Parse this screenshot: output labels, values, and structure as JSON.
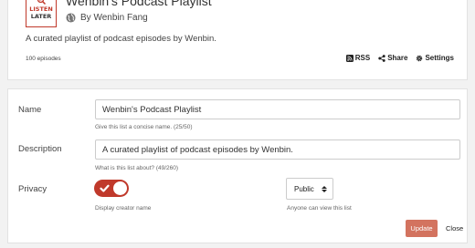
{
  "logo": {
    "line1": "LISTEN",
    "line2": "LATER"
  },
  "header": {
    "title": "Wenbin's Podcast Playlist",
    "byline": "By Wenbin Fang",
    "description": "A curated playlist of podcast episodes by Wenbin.",
    "episode_count": "100 episodes",
    "actions": {
      "rss": "RSS",
      "share": "Share",
      "settings": "Settings"
    }
  },
  "form": {
    "name": {
      "label": "Name",
      "value": "Wenbin's Podcast Playlist",
      "hint": "Give this list a concise name. (25/50)"
    },
    "description": {
      "label": "Description",
      "value": "A curated playlist of podcast episodes by Wenbin.",
      "hint": "What is this list about? (49/260)"
    },
    "privacy": {
      "label": "Privacy",
      "toggle_on": true,
      "toggle_hint": "Display creator name",
      "select_value": "Public",
      "select_hint": "Anyone can view this list"
    },
    "update_label": "Update",
    "close_label": "Close"
  },
  "colors": {
    "accent": "#c0392b",
    "update_button": "#d3735f",
    "background": "#f2f2f2"
  }
}
